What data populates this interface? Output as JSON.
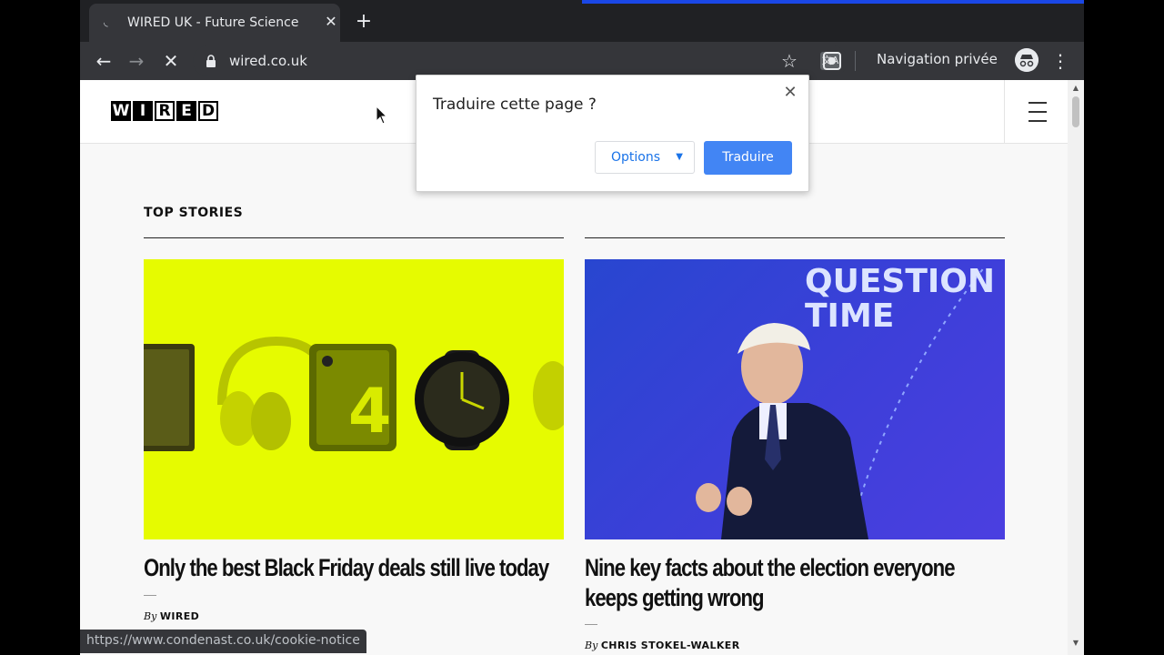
{
  "browser": {
    "tab": {
      "title": "WIRED UK - Future Science",
      "favicon": "loading-spinner-icon"
    },
    "address": {
      "url": "wired.co.uk"
    },
    "profile_label": "Navigation privée",
    "status_url": "https://www.condenast.co.uk/cookie-notice",
    "colors": {
      "frame": "#202124",
      "toolbar": "#35363a",
      "loading": "#1a47e6"
    }
  },
  "translate_popup": {
    "title": "Traduire cette page  ?",
    "options_label": "Options",
    "translate_label": "Traduire",
    "accent": "#4285f4"
  },
  "site": {
    "logo_letters": [
      "W",
      "I",
      "R",
      "E",
      "D"
    ],
    "section_title": "TOP STORIES",
    "stories": [
      {
        "headline": "Only the best Black Friday deals still live today",
        "by": "By",
        "author": "WIRED",
        "image_color": "#e6fb00"
      },
      {
        "headline": "Nine key facts about the election everyone keeps getting wrong",
        "by": "By",
        "author": "CHRIS STOKEL-WALKER",
        "image_text_lines": [
          "QUESTION",
          "TIME"
        ],
        "image_color": "#3d3fd9"
      }
    ]
  }
}
